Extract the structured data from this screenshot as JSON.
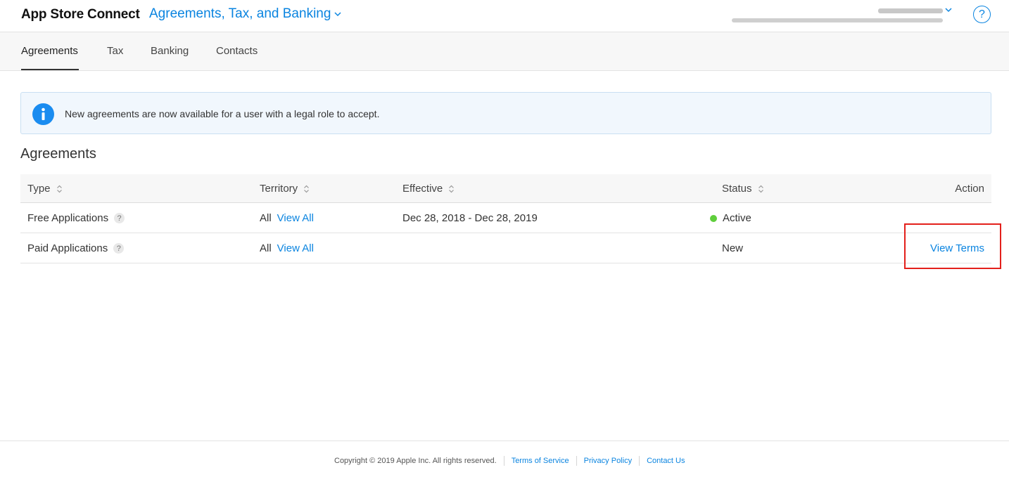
{
  "header": {
    "app_title": "App Store Connect",
    "section_title": "Agreements, Tax, and Banking",
    "help_label": "?"
  },
  "tabs": [
    {
      "label": "Agreements",
      "active": true
    },
    {
      "label": "Tax",
      "active": false
    },
    {
      "label": "Banking",
      "active": false
    },
    {
      "label": "Contacts",
      "active": false
    }
  ],
  "alert": {
    "icon": "info-icon",
    "message": "New agreements are now available for a user with a legal role to accept."
  },
  "agreements": {
    "heading": "Agreements",
    "columns": {
      "type": "Type",
      "territory": "Territory",
      "effective": "Effective",
      "status": "Status",
      "action": "Action"
    },
    "rows": [
      {
        "type": "Free Applications",
        "help": "?",
        "territory": "All",
        "territory_link": "View All",
        "effective": "Dec 28, 2018 - Dec 28, 2019",
        "status": "Active",
        "action": ""
      },
      {
        "type": "Paid Applications",
        "help": "?",
        "territory": "All",
        "territory_link": "View All",
        "effective": "",
        "status": "New",
        "action": "View Terms"
      }
    ]
  },
  "footer": {
    "copyright": "Copyright © 2019 Apple Inc. All rights reserved.",
    "terms": "Terms of Service",
    "privacy": "Privacy Policy",
    "contact": "Contact Us"
  },
  "colors": {
    "accent": "#0a84e0",
    "active_status": "#5fce3c",
    "highlight": "#e3201b"
  }
}
